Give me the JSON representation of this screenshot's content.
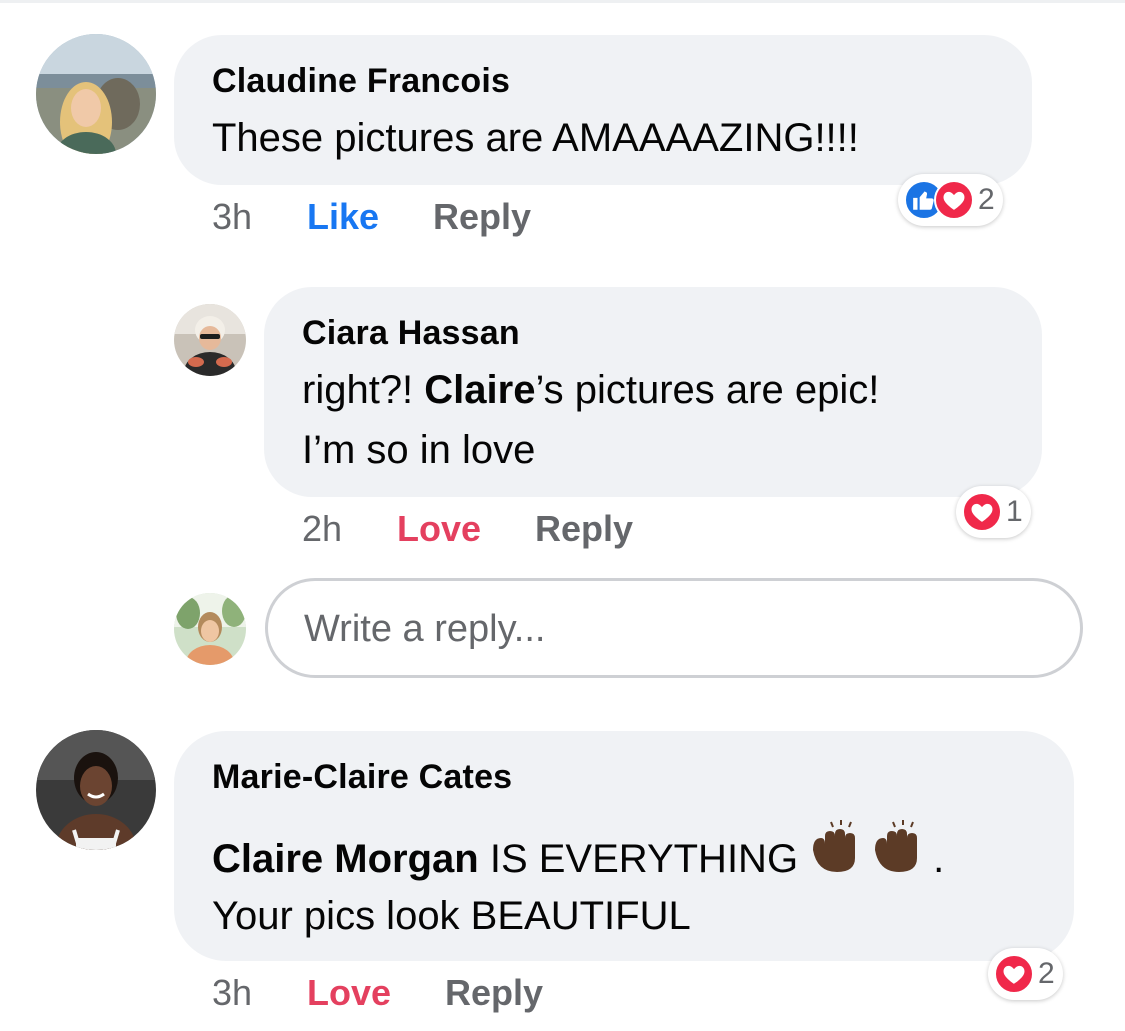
{
  "comments": [
    {
      "author": "Claudine Francois",
      "text": "These pictures are AMAAAAZING!!!!",
      "time": "3h",
      "action": "Like",
      "reply_label": "Reply",
      "reaction_count": "2",
      "reaction_icons": [
        "like-icon",
        "love-icon"
      ]
    },
    {
      "author": "Ciara Hassan",
      "text_line1_pre": "right?! ",
      "text_line1_mention": "Claire",
      "text_line1_post": "’s pictures are epic!",
      "text_line2": "I’m so in love",
      "time": "2h",
      "action": "Love",
      "reply_label": "Reply",
      "reaction_count": "1",
      "reaction_icons": [
        "love-icon"
      ]
    },
    {
      "author": "Marie-Claire Cates",
      "text_line1_mention": "Claire Morgan",
      "text_line1_post": " IS EVERYTHING ",
      "text_line1_end": ".",
      "text_line2": "Your pics look BEAUTIFUL",
      "emoji": "raising-hands-icon",
      "time": "3h",
      "action": "Love",
      "reply_label": "Reply",
      "reaction_count": "2",
      "reaction_icons": [
        "love-icon"
      ]
    }
  ],
  "reply_input": {
    "placeholder": "Write a reply...",
    "value": ""
  },
  "colors": {
    "bubble": "#f0f2f5",
    "like": "#1877f2",
    "love": "#e4405f",
    "meta": "#65676b"
  }
}
